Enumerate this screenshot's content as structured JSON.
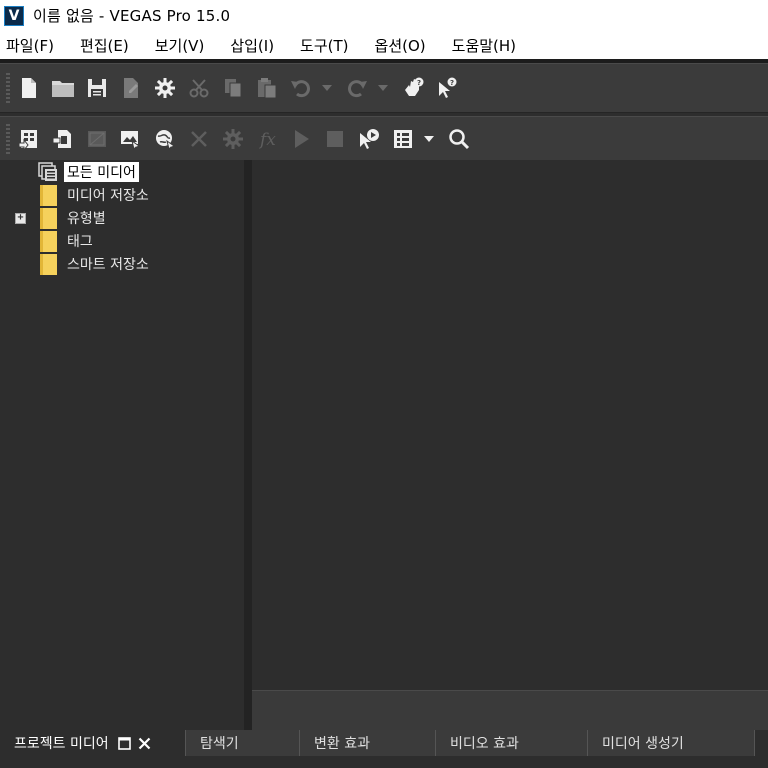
{
  "window": {
    "logo_letter": "V",
    "title": "이름 없음 - VEGAS Pro 15.0"
  },
  "menu": {
    "items": [
      "파일(F)",
      "편집(E)",
      "보기(V)",
      "삽입(I)",
      "도구(T)",
      "옵션(O)",
      "도움말(H)"
    ]
  },
  "toolbar_main": {
    "buttons": [
      "new-project",
      "open",
      "save",
      "properties",
      "settings",
      "cut",
      "copy",
      "paste",
      "undo",
      "undo-dropdown",
      "redo",
      "redo-dropdown",
      "whats-this",
      "help"
    ]
  },
  "toolbar_media": {
    "buttons": [
      "import-media",
      "capture-video",
      "get-media-from-web",
      "remove-unused-media",
      "media-fx",
      "remove-media",
      "media-generators",
      "fx",
      "play",
      "stop",
      "auto-preview",
      "views",
      "views-dropdown",
      "search"
    ]
  },
  "tree": {
    "items": [
      {
        "label": "모든 미디어",
        "selected": true,
        "expandable": false
      },
      {
        "label": "미디어 저장소",
        "selected": false,
        "expandable": false
      },
      {
        "label": "유형별",
        "selected": false,
        "expandable": true,
        "expander": "+"
      },
      {
        "label": "태그",
        "selected": false,
        "expandable": false
      },
      {
        "label": "스마트 저장소",
        "selected": false,
        "expandable": false
      }
    ]
  },
  "tabs": {
    "items": [
      "프로젝트 미디어",
      "탐색기",
      "변환 효과",
      "비디오 효과",
      "미디어 생성기"
    ],
    "active": 0
  },
  "colors": {
    "background": "#2d2d2d",
    "toolbar": "#3b3b3b",
    "folder": "#f5d15c",
    "accent": "#1b7fc4"
  }
}
